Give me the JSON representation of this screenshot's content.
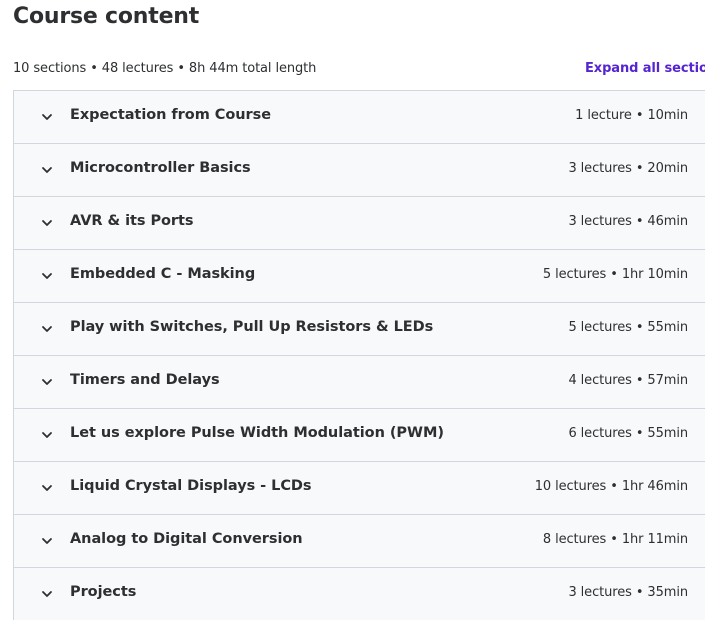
{
  "header": {
    "title": "Course content",
    "summary": "10 sections • 48 lectures • 8h 44m total length",
    "expand_all_label": "Expand all section"
  },
  "sections": [
    {
      "title": "Expectation from Course",
      "meta": "1 lecture • 10min"
    },
    {
      "title": "Microcontroller Basics",
      "meta": "3 lectures • 20min"
    },
    {
      "title": "AVR & its Ports",
      "meta": "3 lectures • 46min"
    },
    {
      "title": "Embedded C - Masking",
      "meta": "5 lectures • 1hr 10min"
    },
    {
      "title": "Play with Switches, Pull Up Resistors & LEDs",
      "meta": "5 lectures • 55min"
    },
    {
      "title": "Timers and Delays",
      "meta": "4 lectures • 57min"
    },
    {
      "title": "Let us explore Pulse Width Modulation (PWM)",
      "meta": "6 lectures • 55min"
    },
    {
      "title": "Liquid Crystal Displays - LCDs",
      "meta": "10 lectures • 1hr 46min"
    },
    {
      "title": "Analog to Digital Conversion",
      "meta": "8 lectures • 1hr 11min"
    },
    {
      "title": "Projects",
      "meta": "3 lectures • 35min"
    }
  ],
  "colors": {
    "accent": "#5624d0",
    "text": "#2d2f31",
    "section_bg": "#f7f9fa",
    "border": "#d1d7dc"
  },
  "icons": {
    "section_toggle": "chevron-down-icon"
  }
}
